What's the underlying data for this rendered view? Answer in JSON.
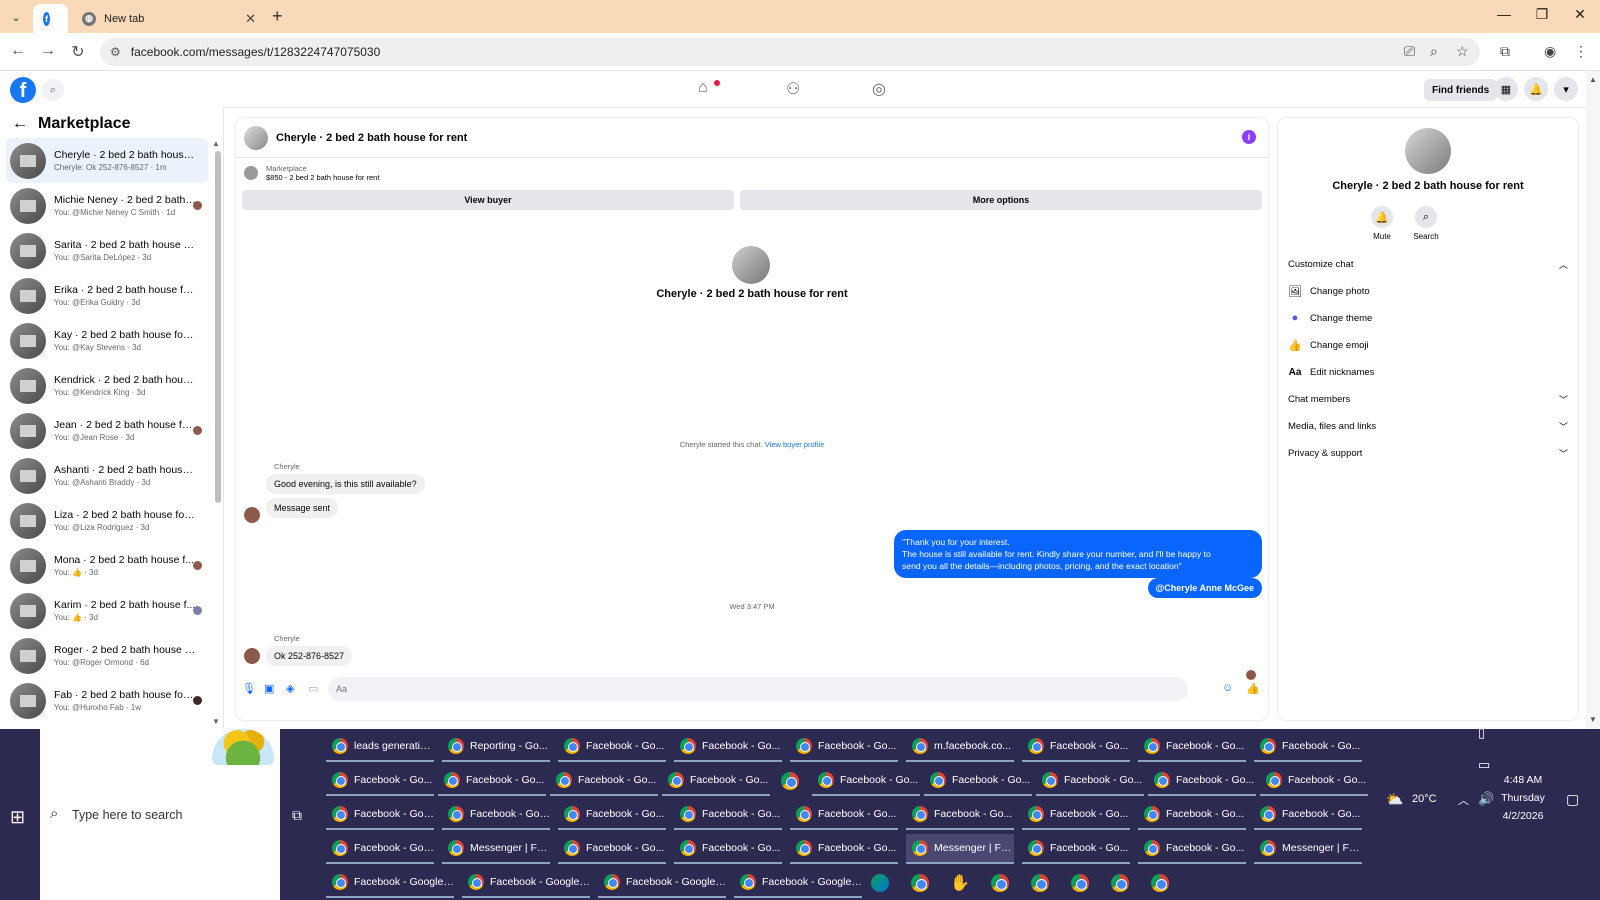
{
  "browser": {
    "tabs": [
      {
        "label": "",
        "icon": "facebook-icon",
        "active": true
      },
      {
        "label": "New tab",
        "icon": "globe-icon",
        "active": false
      }
    ],
    "url": "facebook.com/messages/t/1283224747075030"
  },
  "fb_header": {
    "logo": "f",
    "find_friends_label": "Find friends"
  },
  "sidebar": {
    "title": "Marketplace",
    "conversations": [
      {
        "name": "Cheryle · 2 bed 2 bath house fo...",
        "preview": "Cheryle: Ok 252-876-8527 · 1m",
        "active": true
      },
      {
        "name": "Michie Neney · 2 bed 2 bath ...",
        "preview": "You: @Michie Neney C Smith · 1d"
      },
      {
        "name": "Sarita · 2 bed 2 bath house for r...",
        "preview": "You: @Sarita DeLópez · 3d"
      },
      {
        "name": "Erika · 2 bed 2 bath house for r...",
        "preview": "You: @Erika Guidry · 3d"
      },
      {
        "name": "Kay · 2 bed 2 bath house for rent",
        "preview": "You: @Kay Stevens · 3d"
      },
      {
        "name": "Kendrick · 2 bed 2 bath house f...",
        "preview": "You: @Kendrick King · 3d"
      },
      {
        "name": "Jean · 2 bed 2 bath house for...",
        "preview": "You: @Jean Rose · 3d"
      },
      {
        "name": "Ashanti · 2 bed 2 bath house fo...",
        "preview": "You: @Ashanti Braddy · 3d"
      },
      {
        "name": "Liza · 2 bed 2 bath house for rent",
        "preview": "You: @Liza Rodriguez · 3d"
      },
      {
        "name": "Mona · 2 bed 2 bath house f...",
        "preview": "You: 👍 · 3d"
      },
      {
        "name": "Karim · 2 bed 2 bath house f...",
        "preview": "You: 👍 · 3d"
      },
      {
        "name": "Roger · 2 bed 2 bath house for ...",
        "preview": "You: @Roger Ormond · 6d"
      },
      {
        "name": "Fab · 2 bed 2 bath house for ...",
        "preview": "You: @Hunxho Fab · 1w"
      }
    ]
  },
  "chat": {
    "title": "Cheryle · 2 bed 2 bath house for rent",
    "marketplace_label": "Marketplace",
    "listing": "$850 - 2 bed 2 bath house for rent",
    "view_buyer_label": "View buyer",
    "more_options_label": "More options",
    "hero_name": "Cheryle · 2 bed 2 bath house for rent",
    "started_text": "Cheryle started this chat.",
    "view_buyer_profile": "View buyer profile",
    "sender_1": "Cheryle",
    "msg_1": "Good evening, is this still available?",
    "msg_2": "Message sent",
    "out_line_1": "\"Thank you for your interest.",
    "out_line_2": "The house is still available for rent. Kindly share your number, and I'll be happy to",
    "out_line_3": "send you all the details—including photos, pricing, and the exact location\"",
    "mention": "@Cheryle Anne McGee",
    "timestamp": "Wed 3:47 PM",
    "sender_2": "Cheryle",
    "msg_3": "Ok 252-876-8527",
    "composer_placeholder": "Aa"
  },
  "right_panel": {
    "name": "Cheryle · 2 bed 2 bath house for rent",
    "mute_label": "Mute",
    "search_label": "Search",
    "customize_chat": "Customize chat",
    "change_photo": "Change photo",
    "change_theme": "Change theme",
    "change_emoji": "Change emoji",
    "edit_nicknames_icon": "Aa",
    "edit_nicknames": "Edit nicknames",
    "chat_members": "Chat members",
    "media_files_links": "Media, files and links",
    "privacy_support": "Privacy & support"
  },
  "taskbar": {
    "search_placeholder": "Type here to search",
    "row1": [
      "leads generatio...",
      "Reporting - Go...",
      "Facebook - Go...",
      "Facebook - Go...",
      "Facebook - Go...",
      "m.facebook.co...",
      "Facebook - Go...",
      "Facebook - Go...",
      "Facebook - Go..."
    ],
    "row2": [
      "Facebook - Go...",
      "Facebook - Go...",
      "Facebook - Go...",
      "Facebook - Go...",
      "",
      "Facebook - Go...",
      "Facebook - Go...",
      "Facebook - Go...",
      "Facebook - Go...",
      "Facebook - Go..."
    ],
    "row3": [
      "Facebook - Goo...",
      "Facebook - Goo...",
      "Facebook - Go...",
      "Facebook - Go...",
      "Facebook - Go...",
      "Facebook - Go...",
      "Facebook - Go...",
      "Facebook - Go...",
      "Facebook - Go..."
    ],
    "row4": [
      "Facebook - Goo...",
      "Messenger | Fac...",
      "Facebook - Go...",
      "Facebook - Go...",
      "Facebook - Go...",
      "Messenger | Fa...",
      "Facebook - Go...",
      "Facebook - Go...",
      "Messenger | Fa..."
    ],
    "row5": [
      "Facebook - Google ...",
      "Facebook - Google ...",
      "Facebook - Google ...",
      "Facebook - Google ..."
    ],
    "weather": "20°C",
    "time": "4:48 AM",
    "day": "Thursday",
    "date": "4/2/2026"
  }
}
